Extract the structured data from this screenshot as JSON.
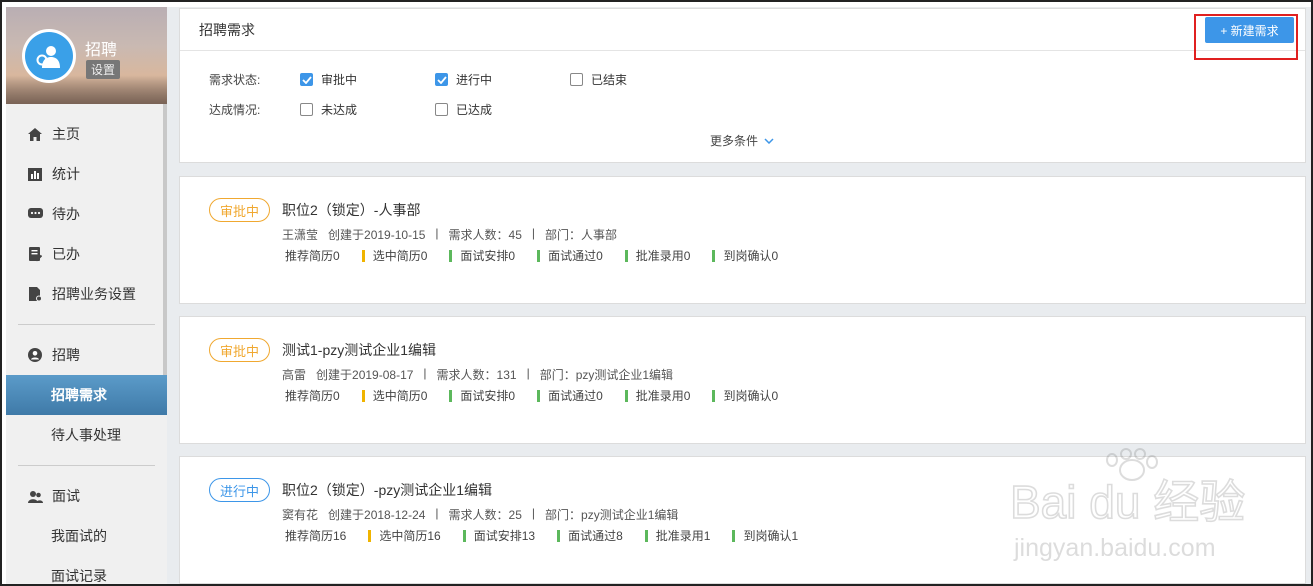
{
  "sidebar": {
    "title": "招聘",
    "settings_label": "设置",
    "nav": [
      {
        "label": "主页",
        "icon": "home-icon"
      },
      {
        "label": "统计",
        "icon": "bar-chart-icon"
      },
      {
        "label": "待办",
        "icon": "chat-bubble-icon"
      },
      {
        "label": "已办",
        "icon": "done-document-icon"
      },
      {
        "label": "招聘业务设置",
        "icon": "file-settings-icon"
      },
      {
        "label": "招聘",
        "icon": "user-circle-icon"
      },
      {
        "label": "招聘需求"
      },
      {
        "label": "待人事处理"
      },
      {
        "label": "面试",
        "icon": "people-icon"
      },
      {
        "label": "我面试的"
      },
      {
        "label": "面试记录"
      }
    ]
  },
  "header": {
    "title": "招聘需求",
    "new_button": "+ 新建需求"
  },
  "filters": {
    "status_label": "需求状态:",
    "status_options": [
      {
        "label": "审批中",
        "checked": true
      },
      {
        "label": "进行中",
        "checked": true
      },
      {
        "label": "已结束",
        "checked": false
      }
    ],
    "achieve_label": "达成情况:",
    "achieve_options": [
      {
        "label": "未达成",
        "checked": false
      },
      {
        "label": "已达成",
        "checked": false
      }
    ],
    "more_label": "更多条件"
  },
  "colors": {
    "accent": "#3d96e8",
    "pending": "#f0a830",
    "stat_yellow": "#f0b400",
    "stat_green": "#5cb85c",
    "highlight": "#e02020"
  },
  "cards": [
    {
      "status": "审批中",
      "title": "职位2（锁定）-人事部",
      "creator": "王潇莹",
      "created": "创建于2019-10-15",
      "headcount": "需求人数：45",
      "dept": "部门：人事部",
      "stats": [
        "推荐简历0",
        "选中简历0",
        "面试安排0",
        "面试通过0",
        "批准录用0",
        "到岗确认0"
      ]
    },
    {
      "status": "审批中",
      "title": "测试1-pzy测试企业1编辑",
      "creator": "高雷",
      "created": "创建于2019-08-17",
      "headcount": "需求人数：131",
      "dept": "部门：pzy测试企业1编辑",
      "stats": [
        "推荐简历0",
        "选中简历0",
        "面试安排0",
        "面试通过0",
        "批准录用0",
        "到岗确认0"
      ]
    },
    {
      "status": "进行中",
      "title": "职位2（锁定）-pzy测试企业1编辑",
      "creator": "窦有花",
      "created": "创建于2018-12-24",
      "headcount": "需求人数：25",
      "dept": "部门：pzy测试企业1编辑",
      "stats": [
        "推荐简历16",
        "选中简历16",
        "面试安排13",
        "面试通过8",
        "批准录用1",
        "到岗确认1"
      ]
    }
  ],
  "watermark": {
    "brand": "Bai du 经验",
    "url": "jingyan.baidu.com"
  }
}
